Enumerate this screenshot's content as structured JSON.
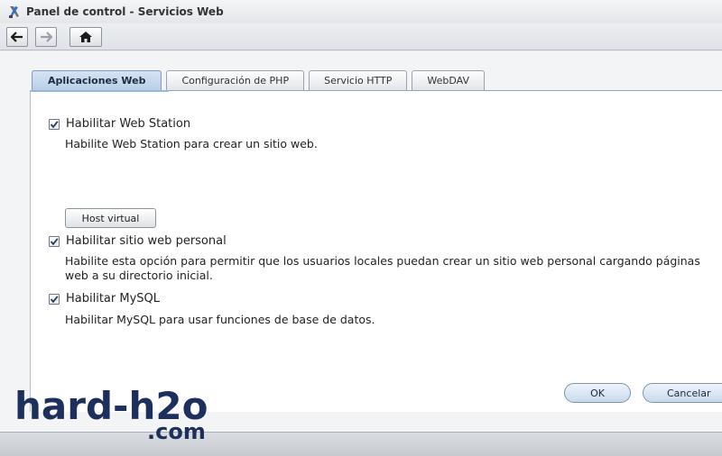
{
  "window": {
    "title": "Panel de control - Servicios Web",
    "icon": "control-panel-icon"
  },
  "toolbar": {
    "back_icon": "arrow-left-icon",
    "forward_icon": "arrow-right-icon",
    "home_icon": "home-icon"
  },
  "tabs": [
    {
      "label": "Aplicaciones Web",
      "active": true
    },
    {
      "label": "Configuración de PHP",
      "active": false
    },
    {
      "label": "Servicio HTTP",
      "active": false
    },
    {
      "label": "WebDAV",
      "active": false
    }
  ],
  "options": [
    {
      "label": "Habilitar Web Station",
      "checked": true,
      "description": "Habilite Web Station para crear un sitio web."
    },
    {
      "label": "Habilitar sitio web personal",
      "checked": true,
      "description_line1": "Habilite esta opción para permitir que los usuarios locales puedan crear un sitio web personal cargando páginas",
      "description_line2": "web a su directorio inicial."
    },
    {
      "label": "Habilitar MySQL",
      "checked": true,
      "description": "Habilitar MySQL para usar funciones de base de datos."
    }
  ],
  "host_button": {
    "label": "Host virtual"
  },
  "footer": {
    "ok_label": "OK",
    "cancel_label": "Cancelar"
  },
  "watermark": {
    "line1": "hard-h2o",
    "line2": ".com"
  },
  "colors": {
    "accent": "#b9cfe7",
    "watermark": "#1d2f5c"
  }
}
